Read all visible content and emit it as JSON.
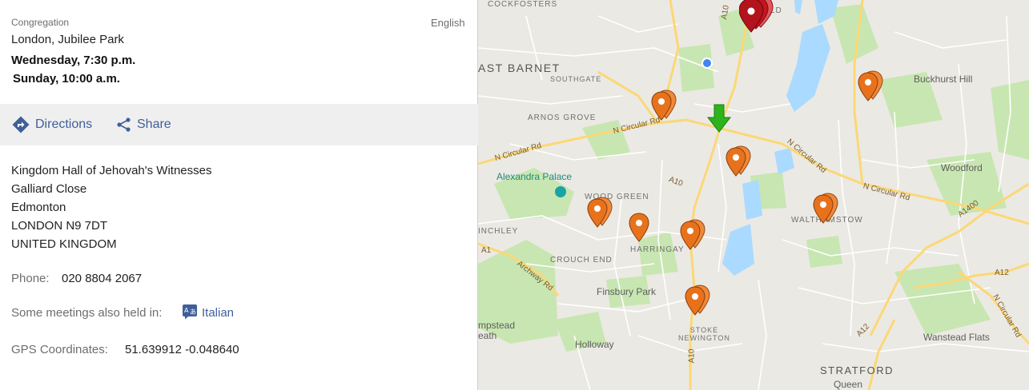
{
  "congregation": {
    "section_label": "Congregation",
    "language": "English",
    "name": "London, Jubilee Park",
    "meeting_1": "Wednesday, 7:30 p.m.",
    "meeting_2": "Sunday, 10:00 a.m."
  },
  "actions": {
    "directions_label": "Directions",
    "share_label": "Share"
  },
  "address": {
    "line1": "Kingdom Hall of Jehovah's Witnesses",
    "line2": "Galliard Close",
    "line3": "Edmonton",
    "line4": "LONDON N9 7DT",
    "line5": "UNITED KINGDOM"
  },
  "phone": {
    "label": "Phone:",
    "value": "020 8804 2067"
  },
  "other_meetings": {
    "label": "Some meetings also held in:",
    "language": "Italian"
  },
  "gps": {
    "label": "GPS Coordinates:",
    "value": "51.639912 -0.048640"
  },
  "map": {
    "labels": {
      "cockfosters": "COCKFOSTERS",
      "east_barnet": "AST BARNET",
      "southgate": "SOUTHGATE",
      "arnos_grove": "ARNOS GROVE",
      "n_circular_1": "N Circular Rd",
      "n_circular_2": "N Circular Rd",
      "n_circular_3": "N Circular Rd",
      "n_circular_4": "N Circular Rd",
      "n_circular_5": "N Circular Rd",
      "alexandra_palace": "Alexandra Palace",
      "wood_green": "WOOD GREEN",
      "finchley": "INCHLEY",
      "a1": "A1",
      "archway_rd": "Archway Rd",
      "crouch_end": "CROUCH END",
      "harringay": "HARRINGAY",
      "finsbury_park": "Finsbury Park",
      "a10_1": "A10",
      "a10_2": "A10",
      "a10_3": "A10",
      "stoke_newington": "STOKE\nNEWINGTON",
      "holloway": "Holloway",
      "hampstead_heath": "mpstead\neath",
      "buckhurst_hill": "Buckhurst Hill",
      "woodford": "Woodford",
      "walthamstow": "WALTHAMSTOW",
      "a1400": "A1400",
      "a12_1": "A12",
      "a12_2": "A12",
      "wanstead_flats": "Wanstead Flats",
      "stratford": "STRATFORD",
      "queen": "Queen",
      "enfield_partial": "LD"
    }
  },
  "colors": {
    "accent_link": "#3f5f9a",
    "pin_orange": "#e8721c",
    "pin_red": "#b3131c",
    "arrow_green": "#2db31d",
    "water": "#aadaff",
    "park": "#c8e6b1",
    "road_major": "#fbd876"
  }
}
